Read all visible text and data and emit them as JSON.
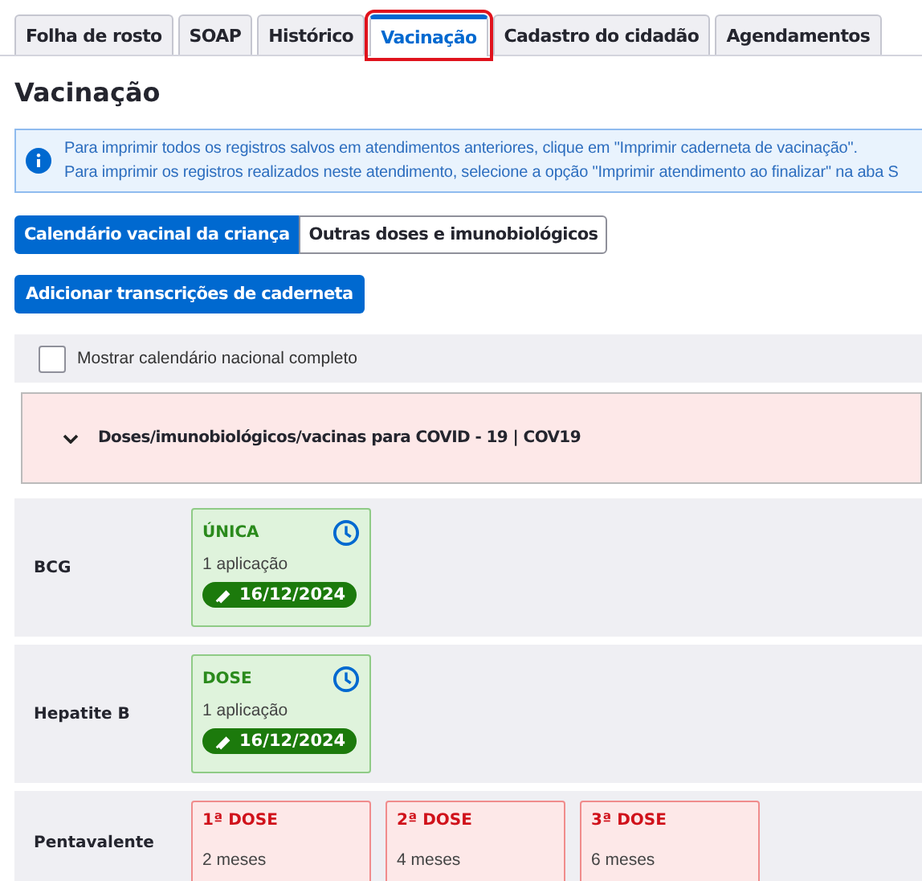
{
  "tabs": [
    {
      "label": "Folha de rosto",
      "selected": false,
      "highlighted": false
    },
    {
      "label": "SOAP",
      "selected": false,
      "highlighted": false
    },
    {
      "label": "Histórico",
      "selected": false,
      "highlighted": false
    },
    {
      "label": "Vacinação",
      "selected": true,
      "highlighted": true
    },
    {
      "label": "Cadastro do cidadão",
      "selected": false,
      "highlighted": false
    },
    {
      "label": "Agendamentos",
      "selected": false,
      "highlighted": false
    }
  ],
  "heading": "Vacinação",
  "info": [
    "Para imprimir todos os registros salvos em atendimentos anteriores, clique em \"Imprimir caderneta de vacinação\".",
    "Para imprimir os registros realizados neste atendimento, selecione a opção \"Imprimir atendimento ao finalizar\" na aba S"
  ],
  "segments": [
    {
      "label": "Calendário vacinal da criança",
      "selected": true
    },
    {
      "label": "Outras doses e imunobiológicos",
      "selected": false
    }
  ],
  "add_button": "Adicionar transcrições de caderneta",
  "show_full": {
    "label": "Mostrar calendário nacional completo",
    "checked": false
  },
  "covid_section": {
    "label": "Doses/imunobiológicos/vacinas para COVID - 19 | COV19",
    "expanded": false
  },
  "vaccines": [
    {
      "name": "BCG",
      "doses": [
        {
          "kind": "done",
          "title": "ÚNICA",
          "detail": "1 aplicação",
          "date": "16/12/2024"
        }
      ]
    },
    {
      "name": "Hepatite B",
      "doses": [
        {
          "kind": "done",
          "title": "DOSE",
          "detail": "1 aplicação",
          "date": "16/12/2024"
        }
      ]
    },
    {
      "name": "Pentavalente",
      "doses": [
        {
          "kind": "pending",
          "title": "1ª DOSE",
          "detail": "2 meses"
        },
        {
          "kind": "pending",
          "title": "2ª DOSE",
          "detail": "4 meses"
        },
        {
          "kind": "pending",
          "title": "3ª DOSE",
          "detail": "6 meses"
        }
      ]
    }
  ]
}
